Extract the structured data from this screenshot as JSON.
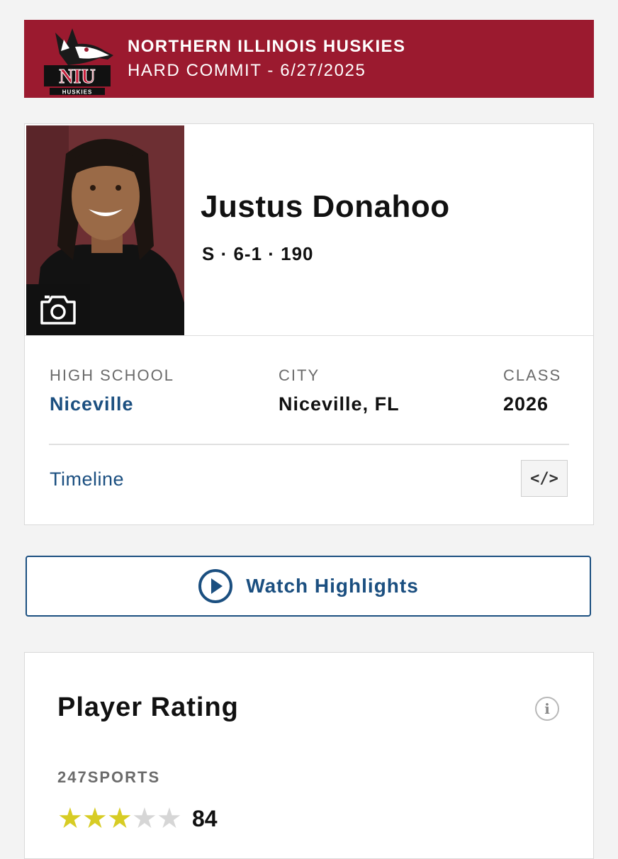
{
  "commit": {
    "team": "NORTHERN ILLINOIS HUSKIES",
    "status": "HARD COMMIT - 6/27/2025",
    "logo_text": "NIU",
    "logo_subtext": "HUSKIES",
    "color": "#9b1a2f"
  },
  "player": {
    "name": "Justus Donahoo",
    "meta": "S · 6-1 · 190",
    "photo_icon": "camera-icon"
  },
  "info": {
    "high_school_label": "HIGH SCHOOL",
    "high_school": "Niceville",
    "city_label": "CITY",
    "city": "Niceville, FL",
    "class_label": "CLASS",
    "class": "2026"
  },
  "links": {
    "timeline": "Timeline",
    "embed_icon": "code-embed-icon",
    "embed_label": "</>"
  },
  "highlights": {
    "label": "Watch Highlights",
    "icon": "play-circle-icon"
  },
  "rating": {
    "title": "Player Rating",
    "info_icon": "i",
    "source": "247SPORTS",
    "stars_filled": 3,
    "stars_total": 5,
    "score": "84",
    "star_color": "#d7cc24"
  },
  "colors": {
    "link": "#1b4f80"
  }
}
